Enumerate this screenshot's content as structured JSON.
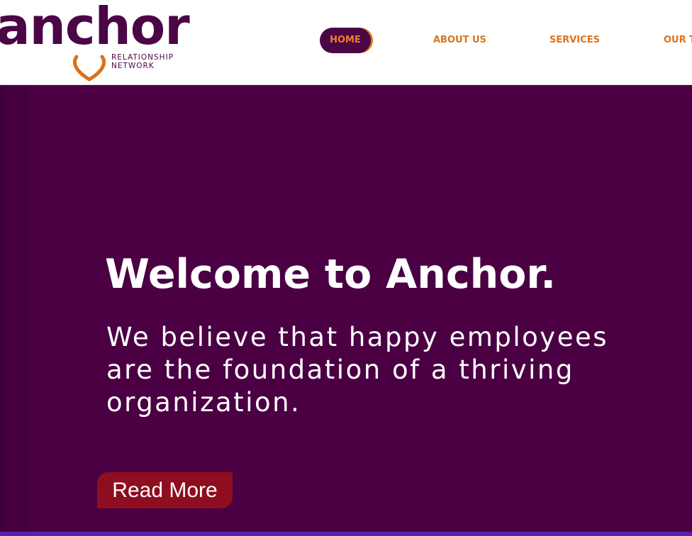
{
  "header": {
    "logo": {
      "wordmark": "anchor",
      "subtitle_line1": "RELATIONSHIP",
      "subtitle_line2": "NETWORK",
      "heart_icon": "heart-outline-icon",
      "colors": {
        "wordmark": "#4b0645",
        "heart": "#d9731d"
      }
    },
    "nav": {
      "items": [
        {
          "label": "HOME",
          "active": true
        },
        {
          "label": "ABOUT US",
          "active": false
        },
        {
          "label": "SERVICES",
          "active": false
        },
        {
          "label": "OUR TE",
          "active": false
        }
      ],
      "colors": {
        "text": "#d9731d",
        "active_bg": "#4b0645"
      }
    }
  },
  "hero": {
    "title": "Welcome to Anchor.",
    "subtitle_lines": [
      "We believe that happy employees",
      "are the foundation of a thriving",
      "organization."
    ],
    "cta_label": "Read More",
    "colors": {
      "background": "#4a0043",
      "cta": "#8e0d1e",
      "bottom_bar": "#5a1fb0"
    }
  }
}
